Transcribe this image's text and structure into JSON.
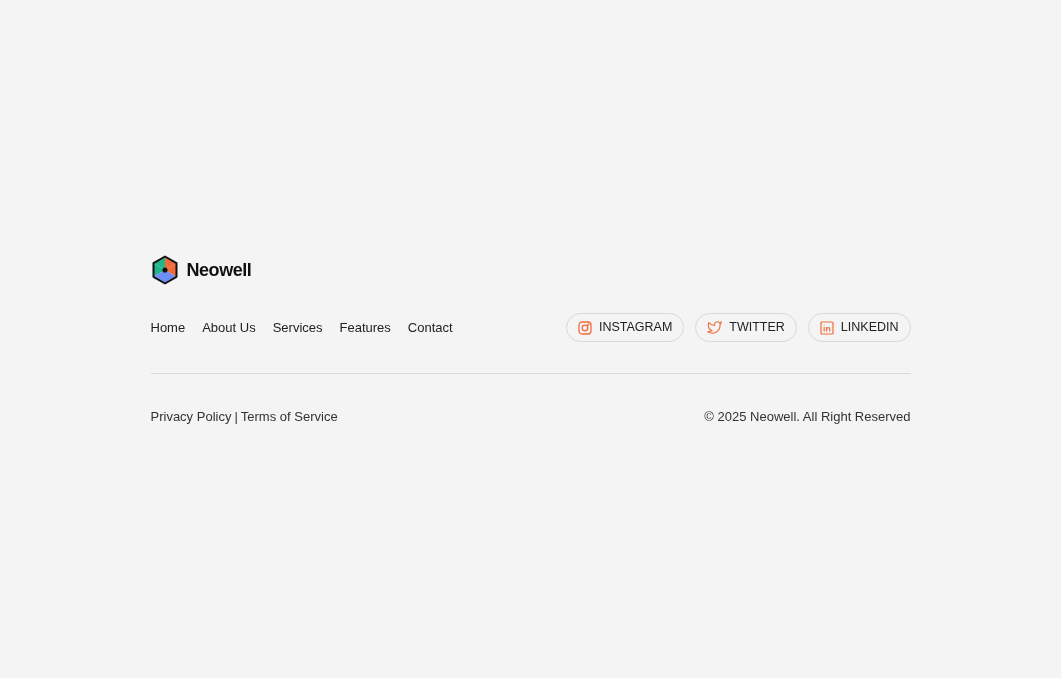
{
  "brand": {
    "name": "Neowell"
  },
  "nav": [
    "Home",
    "About Us",
    "Services",
    "Features",
    "Contact"
  ],
  "socials": [
    {
      "kind": "instagram",
      "label": "INSTAGRAM"
    },
    {
      "kind": "twitter",
      "label": "TWITTER"
    },
    {
      "kind": "linkedin",
      "label": "LINKEDIN"
    }
  ],
  "legal_links": [
    "Privacy Policy",
    "Terms of Service"
  ],
  "separator": "|",
  "copyright": "© 2025 Neowell. All Right Reserved"
}
